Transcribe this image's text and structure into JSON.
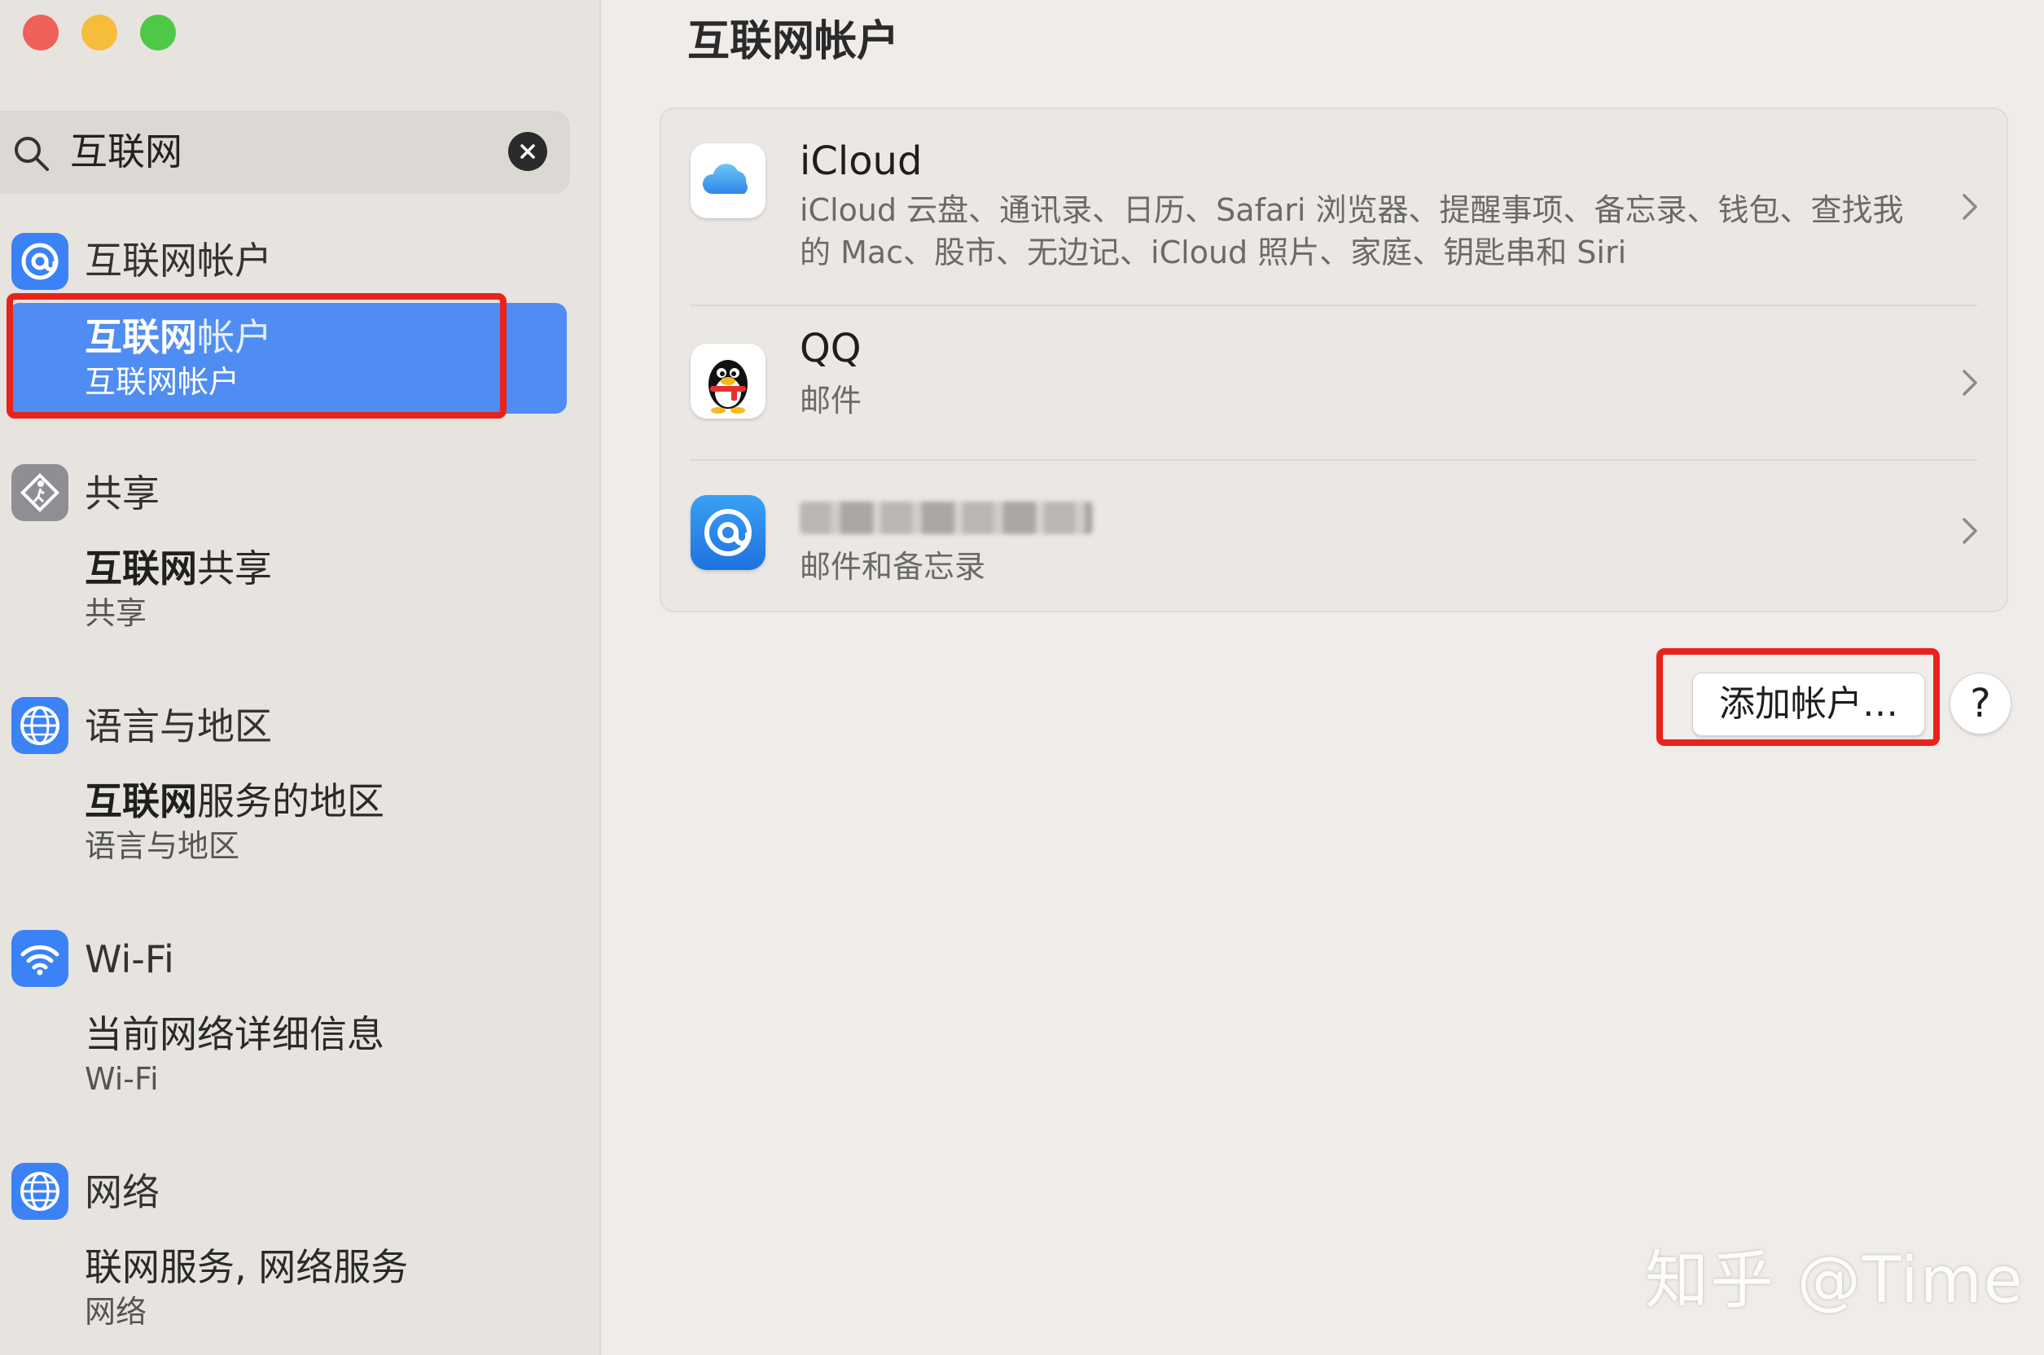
{
  "window": {
    "controls": [
      "close",
      "minimize",
      "zoom"
    ]
  },
  "search": {
    "query": "互联网",
    "icon": "search-icon",
    "clear_icon": "clear-icon"
  },
  "sidebar": {
    "sections": [
      {
        "title": "互联网帐户",
        "icon": "at-icon",
        "icon_color": "#3b82f6",
        "results": [
          {
            "title_bold": "互联网",
            "title_rest": "帐户",
            "subtitle": "互联网帐户",
            "selected": true
          }
        ]
      },
      {
        "title": "共享",
        "icon": "sharing-icon",
        "icon_color": "#8e8e93",
        "results": [
          {
            "title_bold": "互联网",
            "title_rest": "共享",
            "subtitle": "共享",
            "selected": false
          }
        ]
      },
      {
        "title": "语言与地区",
        "icon": "globe-icon",
        "icon_color": "#3b82f6",
        "results": [
          {
            "title_bold": "互联网",
            "title_rest": "服务的地区",
            "subtitle": "语言与地区",
            "selected": false
          }
        ]
      },
      {
        "title": "Wi-Fi",
        "icon": "wifi-icon",
        "icon_color": "#3b82f6",
        "results": [
          {
            "title_bold": "",
            "title_rest": "当前网络详细信息",
            "subtitle": "Wi-Fi",
            "selected": false
          }
        ]
      },
      {
        "title": "网络",
        "icon": "network-globe-icon",
        "icon_color": "#3b82f6",
        "results": [
          {
            "title_bold": "",
            "title_rest": "联网服务, 网络服务",
            "subtitle": "网络",
            "selected": false
          }
        ]
      }
    ]
  },
  "main": {
    "title": "互联网帐户",
    "accounts": [
      {
        "name": "iCloud",
        "description": "iCloud 云盘、通讯录、日历、Safari 浏览器、提醒事项、备忘录、钱包、查找我的 Mac、股市、无边记、iCloud 照片、家庭、钥匙串和 Siri",
        "icon": "icloud-icon"
      },
      {
        "name": "QQ",
        "description": "邮件",
        "icon": "qq-penguin-icon"
      },
      {
        "name": "",
        "description": "邮件和备忘录",
        "icon": "at-mail-icon",
        "name_redacted": true
      }
    ],
    "add_button": "添加帐户…",
    "help_button": "?"
  },
  "watermark": "知乎 @Time",
  "colors": {
    "accent": "#4f8df2",
    "highlight": "#e8231c"
  }
}
